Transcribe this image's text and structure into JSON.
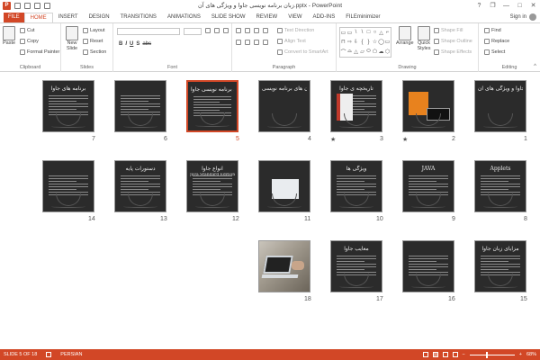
{
  "app": {
    "logo_letter": "P",
    "title": "زبان برنامه نویسی جاوا و ویژگی های آن.pptx - PowerPoint"
  },
  "window_controls": {
    "help": "?",
    "restore": "❐",
    "minimize": "—",
    "maximize": "□",
    "close": "✕"
  },
  "tabs": [
    {
      "label": "FILE"
    },
    {
      "label": "HOME"
    },
    {
      "label": "INSERT"
    },
    {
      "label": "DESIGN"
    },
    {
      "label": "TRANSITIONS"
    },
    {
      "label": "ANIMATIONS"
    },
    {
      "label": "SLIDE SHOW"
    },
    {
      "label": "REVIEW"
    },
    {
      "label": "VIEW"
    },
    {
      "label": "ADD-INS"
    },
    {
      "label": "FILEminimizer"
    }
  ],
  "active_tab": "HOME",
  "signin": {
    "label": "Sign in"
  },
  "ribbon": {
    "clipboard": {
      "label": "Clipboard",
      "paste": "Paste",
      "cut": "Cut",
      "copy": "Copy",
      "format_painter": "Format Painter"
    },
    "slides": {
      "label": "Slides",
      "new_slide": "New Slide",
      "layout": "Layout",
      "reset": "Reset",
      "section": "Section"
    },
    "font": {
      "label": "Font",
      "bold": "B",
      "italic": "I",
      "underline": "U",
      "shadow": "S",
      "strike": "abc"
    },
    "paragraph": {
      "label": "Paragraph",
      "text_direction": "Text Direction",
      "align_text": "Align Text",
      "convert_smartart": "Convert to SmartArt"
    },
    "drawing": {
      "label": "Drawing",
      "arrange": "Arrange",
      "quick_styles": "Quick Styles",
      "shape_fill": "Shape Fill",
      "shape_outline": "Shape Outline",
      "shape_effects": "Shape Effects",
      "shape_glyphs": [
        "▭",
        "▭",
        "\\",
        "\\",
        "□",
        "○",
        "△",
        "⌐",
        "⊓",
        "⇨",
        "⇩",
        "{",
        "}",
        "☆",
        "◯",
        "▭",
        "⌒",
        "⌓",
        "△",
        "▱",
        "⬭",
        "⬠",
        "☁",
        "⬡"
      ]
    },
    "editing": {
      "label": "Editing",
      "find": "Find",
      "replace": "Replace",
      "select": "Select"
    }
  },
  "slides": [
    {
      "num": "1",
      "title": "برنامه نویسی جاوا و ویژگی های آن",
      "sub": "",
      "star": false
    },
    {
      "num": "2",
      "title": "",
      "sub": "",
      "star": true
    },
    {
      "num": "3",
      "title": "تاریخچه ی جاوا",
      "sub": "",
      "star": true
    },
    {
      "num": "4",
      "title": "زبان های برنامه نویسی",
      "sub": "",
      "star": false
    },
    {
      "num": "5",
      "title": "اشنایی با زبان برنامه نویسی جاوا",
      "sub": "",
      "star": false,
      "selected": true
    },
    {
      "num": "6",
      "title": "",
      "sub": "",
      "star": false
    },
    {
      "num": "7",
      "title": "برنامه های جاوا",
      "sub": "",
      "star": false
    },
    {
      "num": "8",
      "title": "Applets",
      "sub": "",
      "star": false
    },
    {
      "num": "9",
      "title": "JAVA",
      "sub": "",
      "star": false
    },
    {
      "num": "10",
      "title": "ویژگی ها",
      "sub": "",
      "star": false
    },
    {
      "num": "11",
      "title": "",
      "sub": "",
      "star": false
    },
    {
      "num": "12",
      "title": "انواع جاوا",
      "sub": "Java Standard Edition",
      "star": false
    },
    {
      "num": "13",
      "title": "دستورات پایه",
      "sub": "",
      "star": false
    },
    {
      "num": "14",
      "title": "",
      "sub": "",
      "star": false
    },
    {
      "num": "15",
      "title": "مزایای زبان جاوا",
      "sub": "",
      "star": false
    },
    {
      "num": "16",
      "title": "",
      "sub": "",
      "star": false
    },
    {
      "num": "17",
      "title": "معایب جاوا",
      "sub": "",
      "star": false
    },
    {
      "num": "18",
      "title": "",
      "sub": "",
      "star": false
    }
  ],
  "status": {
    "slide_info": "SLIDE 5 OF 18",
    "language": "PERSIAN",
    "zoom": "68%",
    "zoom_minus": "−",
    "zoom_plus": "+",
    "zoom_level": 0.68
  }
}
